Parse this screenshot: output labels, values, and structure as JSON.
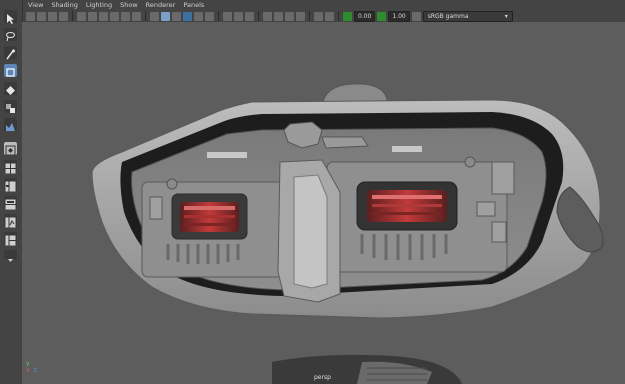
{
  "menu": [
    "View",
    "Shading",
    "Lighting",
    "Show",
    "Renderer",
    "Panels"
  ],
  "toolbar": {
    "exposure": "0.00",
    "gamma": "1.00",
    "colorspace": "sRGB gamma",
    "colorspace_arrow": "▾"
  },
  "viewport": {
    "camera": "persp",
    "axis_y": "y",
    "axis_x": "x",
    "axis_z": "z"
  },
  "colors": {
    "viewport_bg": "#5d5d5d",
    "ui_bg": "#444444",
    "accent_blue": "#5c86b5",
    "mesh": "#9b9b9b",
    "lens_glow": "#c23a3a"
  },
  "icons": [
    "select-tool-icon",
    "lasso-tool-icon",
    "paint-select-icon",
    "move-tool-icon",
    "rotate-tool-icon",
    "scale-tool-icon",
    "last-tool-icon",
    "layout-single-icon",
    "layout-four-icon",
    "layout-side-icon",
    "layout-persp-outliner-icon",
    "layout-graph-icon",
    "layout-outliner-icon"
  ]
}
